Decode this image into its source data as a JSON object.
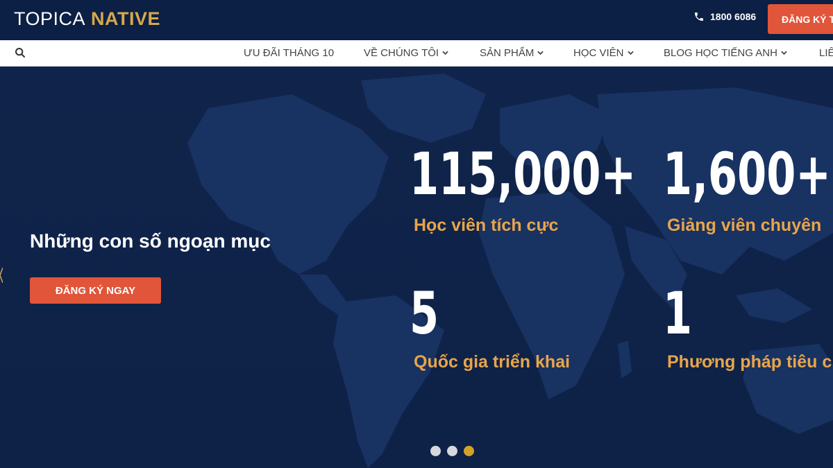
{
  "header": {
    "logo_part1": "TOPICA",
    "logo_part2": "NATIVE",
    "phone": "1800 6086",
    "cta_label": "ĐĂNG KÝ T"
  },
  "nav": {
    "items": [
      {
        "label": "ƯU ĐÃI THÁNG 10",
        "has_dropdown": false
      },
      {
        "label": "VỀ CHÚNG TÔI",
        "has_dropdown": true
      },
      {
        "label": "SẢN PHẨM",
        "has_dropdown": true
      },
      {
        "label": "HỌC VIÊN",
        "has_dropdown": true
      },
      {
        "label": "BLOG HỌC TIẾNG ANH",
        "has_dropdown": true
      },
      {
        "label": "LIÊ",
        "has_dropdown": false
      }
    ]
  },
  "hero": {
    "title": "Những con số ngoạn mục",
    "cta_label": "ĐĂNG KÝ NGAY",
    "stats": [
      {
        "number": "115,000+",
        "label": "Học viên tích cực"
      },
      {
        "number": "1,600+",
        "label": "Giảng viên chuyên"
      },
      {
        "number": "5",
        "label": "Quốc gia triển khai"
      },
      {
        "number": "1",
        "label": "Phương pháp tiêu c"
      }
    ],
    "slider": {
      "count": 3,
      "active_index": 2
    }
  },
  "colors": {
    "navy": "#0c1f44",
    "accent": "#e1553a",
    "gold": "#e8a54b",
    "dot_active": "#d4a128"
  }
}
